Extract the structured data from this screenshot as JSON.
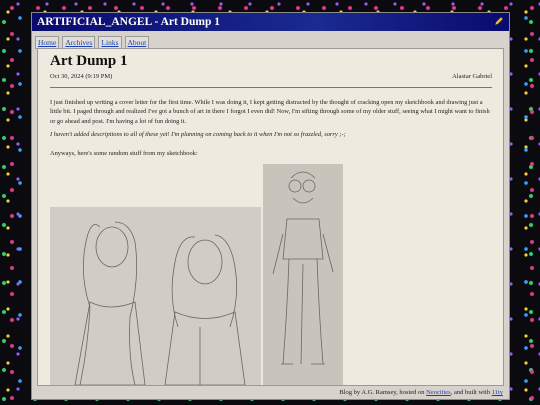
{
  "window": {
    "title": "ARTIFICIAL_ANGEL - Art Dump 1"
  },
  "nav": {
    "home": "Home",
    "archives": "Archives",
    "links": "Links",
    "about": "About"
  },
  "post": {
    "title": "Art Dump 1",
    "date": "Oct 30, 2024 (9:19 PM)",
    "author": "Alastar Gabriel",
    "paragraph1": "I just finished up writing a cover letter for the first time. While I was doing it, I kept getting distracted by the thought of cracking open my sketchbook and drawing just a little bit. I paged through and realized I've got a bunch of art in there I forgot I even did! Now, I'm sifting through some of my older stuff, seeing what I might want to finish or go ahead and post. I'm having a lot of fun doing it.",
    "paragraph2": "I haven't added descriptions to all of these yet! I'm planning on coming back to it when I'm not so frazzled, sorry ;-;",
    "paragraph3": "Anyways, here's some random stuff from my sketchbook:"
  },
  "footer": {
    "prefix": "Blog by A.G. Ramsey, hosted on ",
    "neocities": "Neocities",
    "middle": ", and built with ",
    "eleventy": "11ty"
  }
}
